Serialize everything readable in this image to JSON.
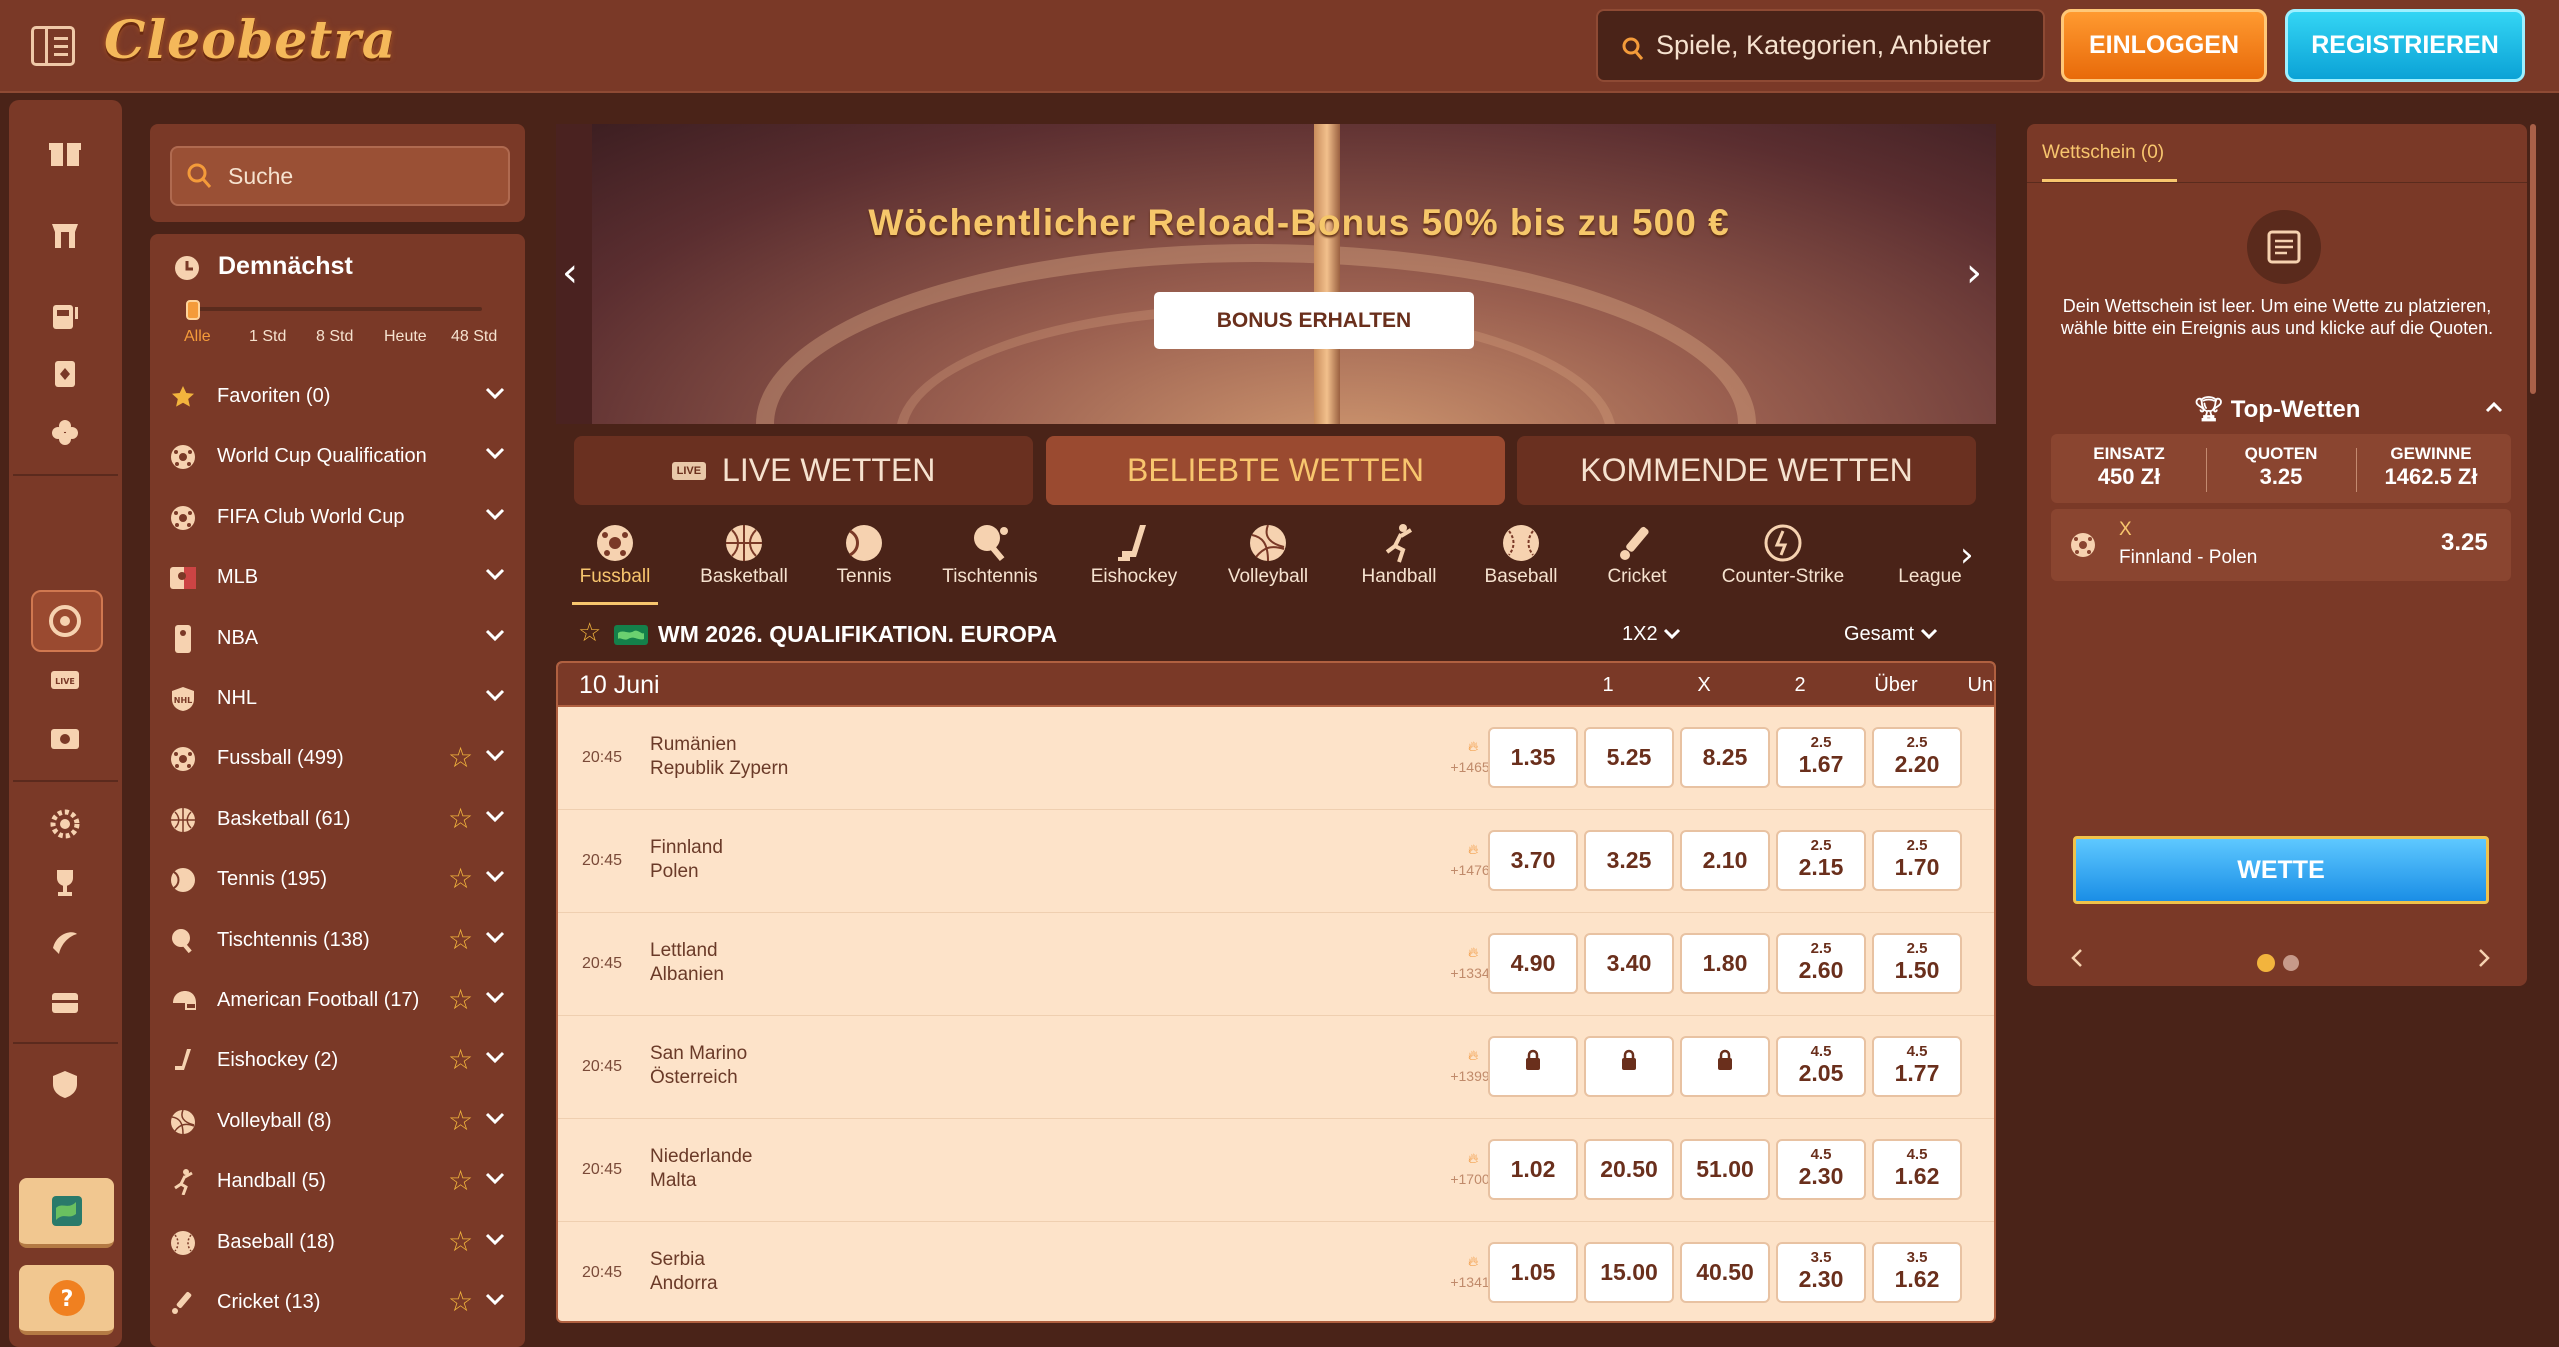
{
  "header": {
    "logo": "Cleobetra",
    "search_placeholder": "Spiele, Kategorien, Anbieter",
    "login": "EINLOGGEN",
    "register": "REGISTRIEREN"
  },
  "rail": {
    "icons": [
      "gift-icon",
      "shop-icon",
      "slot-machine-icon",
      "cards-icon",
      "clover-icon",
      "sports-ball-icon",
      "live-icon",
      "roulette-icon",
      "settings-icon",
      "trophy-icon",
      "surf-icon",
      "chest-icon",
      "shield-icon",
      "world-icon",
      "help-icon"
    ]
  },
  "sidebar": {
    "search_placeholder": "Suche",
    "soon_title": "Demnächst",
    "timeline": [
      "Alle",
      "1 Std",
      "8 Std",
      "Heute",
      "48 Std"
    ],
    "items": [
      {
        "label": "Favoriten (0)",
        "icon": "star-icon",
        "star": false
      },
      {
        "label": "World Cup Qualification",
        "icon": "soccer-icon",
        "star": false
      },
      {
        "label": "FIFA Club World Cup",
        "icon": "soccer-icon",
        "star": false
      },
      {
        "label": "MLB",
        "icon": "mlb-icon",
        "star": false
      },
      {
        "label": "NBA",
        "icon": "nba-icon",
        "star": false
      },
      {
        "label": "NHL",
        "icon": "nhl-icon",
        "star": false
      },
      {
        "label": "Fussball (499)",
        "icon": "soccer-icon",
        "star": true
      },
      {
        "label": "Basketball (61)",
        "icon": "basketball-icon",
        "star": true
      },
      {
        "label": "Tennis (195)",
        "icon": "tennis-icon",
        "star": true
      },
      {
        "label": "Tischtennis (138)",
        "icon": "table-tennis-icon",
        "star": true
      },
      {
        "label": "American Football (17)",
        "icon": "helmet-icon",
        "star": true
      },
      {
        "label": "Eishockey (2)",
        "icon": "hockey-icon",
        "star": true
      },
      {
        "label": "Volleyball (8)",
        "icon": "volleyball-icon",
        "star": true
      },
      {
        "label": "Handball (5)",
        "icon": "handball-icon",
        "star": true
      },
      {
        "label": "Baseball (18)",
        "icon": "baseball-icon",
        "star": true
      },
      {
        "label": "Cricket (13)",
        "icon": "cricket-icon",
        "star": true
      }
    ]
  },
  "banner": {
    "title": "Wöchentlicher Reload-Bonus 50% bis zu 500 €",
    "button": "BONUS ERHALTEN"
  },
  "bet_tabs": {
    "live_badge": "LIVE",
    "live": "LIVE WETTEN",
    "popular": "BELIEBTE WETTEN",
    "upcoming": "KOMMENDE WETTEN"
  },
  "sports": [
    "Fussball",
    "Basketball",
    "Tennis",
    "Tischtennis",
    "Eishockey",
    "Volleyball",
    "Handball",
    "Baseball",
    "Cricket",
    "Counter-Strike",
    "League"
  ],
  "league": {
    "name": "WM 2026. QUALIFIKATION. EUROPA",
    "market": "1X2",
    "filter": "Gesamt"
  },
  "table": {
    "date": "10 Juni",
    "cols": [
      "1",
      "X",
      "2",
      "Über",
      "Unter"
    ],
    "rows": [
      {
        "time": "20:45",
        "team1": "Rumänien",
        "team2": "Republik Zypern",
        "markets": "+1465",
        "o1": "1.35",
        "ox": "5.25",
        "o2": "8.25",
        "ou_line": "2.5",
        "over": "1.67",
        "un_line": "2.5",
        "under": "2.20"
      },
      {
        "time": "20:45",
        "team1": "Finnland",
        "team2": "Polen",
        "markets": "+1476",
        "o1": "3.70",
        "ox": "3.25",
        "o2": "2.10",
        "ou_line": "2.5",
        "over": "2.15",
        "un_line": "2.5",
        "under": "1.70"
      },
      {
        "time": "20:45",
        "team1": "Lettland",
        "team2": "Albanien",
        "markets": "+1334",
        "o1": "4.90",
        "ox": "3.40",
        "o2": "1.80",
        "ou_line": "2.5",
        "over": "2.60",
        "un_line": "2.5",
        "under": "1.50"
      },
      {
        "time": "20:45",
        "team1": "San Marino",
        "team2": "Österreich",
        "markets": "+1399",
        "o1": "",
        "ox": "",
        "o2": "",
        "ou_line": "4.5",
        "over": "2.05",
        "un_line": "4.5",
        "under": "1.77"
      },
      {
        "time": "20:45",
        "team1": "Niederlande",
        "team2": "Malta",
        "markets": "+1700",
        "o1": "1.02",
        "ox": "20.50",
        "o2": "51.00",
        "ou_line": "4.5",
        "over": "2.30",
        "un_line": "4.5",
        "under": "1.62"
      },
      {
        "time": "20:45",
        "team1": "Serbia",
        "team2": "Andorra",
        "markets": "+1341",
        "o1": "1.05",
        "ox": "15.00",
        "o2": "40.50",
        "ou_line": "3.5",
        "over": "2.30",
        "un_line": "3.5",
        "under": "1.62"
      }
    ]
  },
  "slip": {
    "tab": "Wettschein (0)",
    "empty": "Dein Wettschein ist leer. Um eine Wette zu platzieren, wähle bitte ein Ereignis aus und klicke auf die Quoten.",
    "top_title": "Top-Wetten",
    "stake_label": "EINSATZ",
    "stake": "450 Zł",
    "odds_label": "QUOTEN",
    "odds": "3.25",
    "win_label": "GEWINNE",
    "win": "1462.5 Zł",
    "pick": "X",
    "match": "Finnland - Polen",
    "pick_odds": "3.25",
    "bet_button": "WETTE"
  },
  "colors": {
    "accent": "#f8c66e",
    "login": "#f2820e",
    "register": "#16b6e4",
    "bg": "#4a2318",
    "panel": "#7a3927"
  }
}
